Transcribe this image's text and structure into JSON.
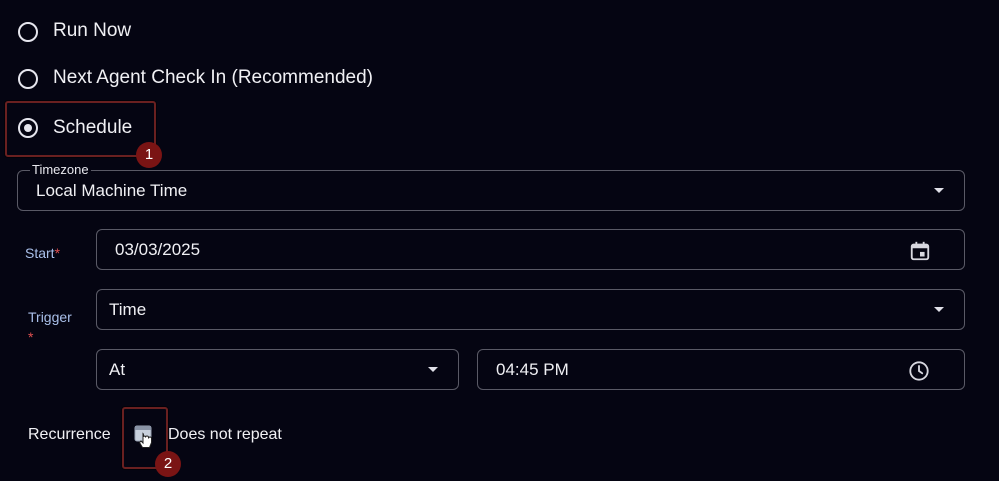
{
  "run_options": {
    "run_now": "Run Now",
    "next_agent": "Next Agent Check In (Recommended)",
    "schedule": "Schedule"
  },
  "timezone": {
    "label": "Timezone",
    "value": "Local Machine Time"
  },
  "start": {
    "label": "Start",
    "required": "*",
    "value": "03/03/2025"
  },
  "trigger": {
    "label": "Trigger",
    "required": "*",
    "value": "Time"
  },
  "at": {
    "value": "At",
    "time": "04:45 PM"
  },
  "recurrence": {
    "label": "Recurrence",
    "value": "Does not repeat"
  },
  "badges": {
    "one": "1",
    "two": "2"
  },
  "colors": {
    "background": "#050512",
    "highlight": "#6a2020",
    "badge": "#7a1414",
    "label_blue": "#aac0ea",
    "required": "#e05050"
  }
}
